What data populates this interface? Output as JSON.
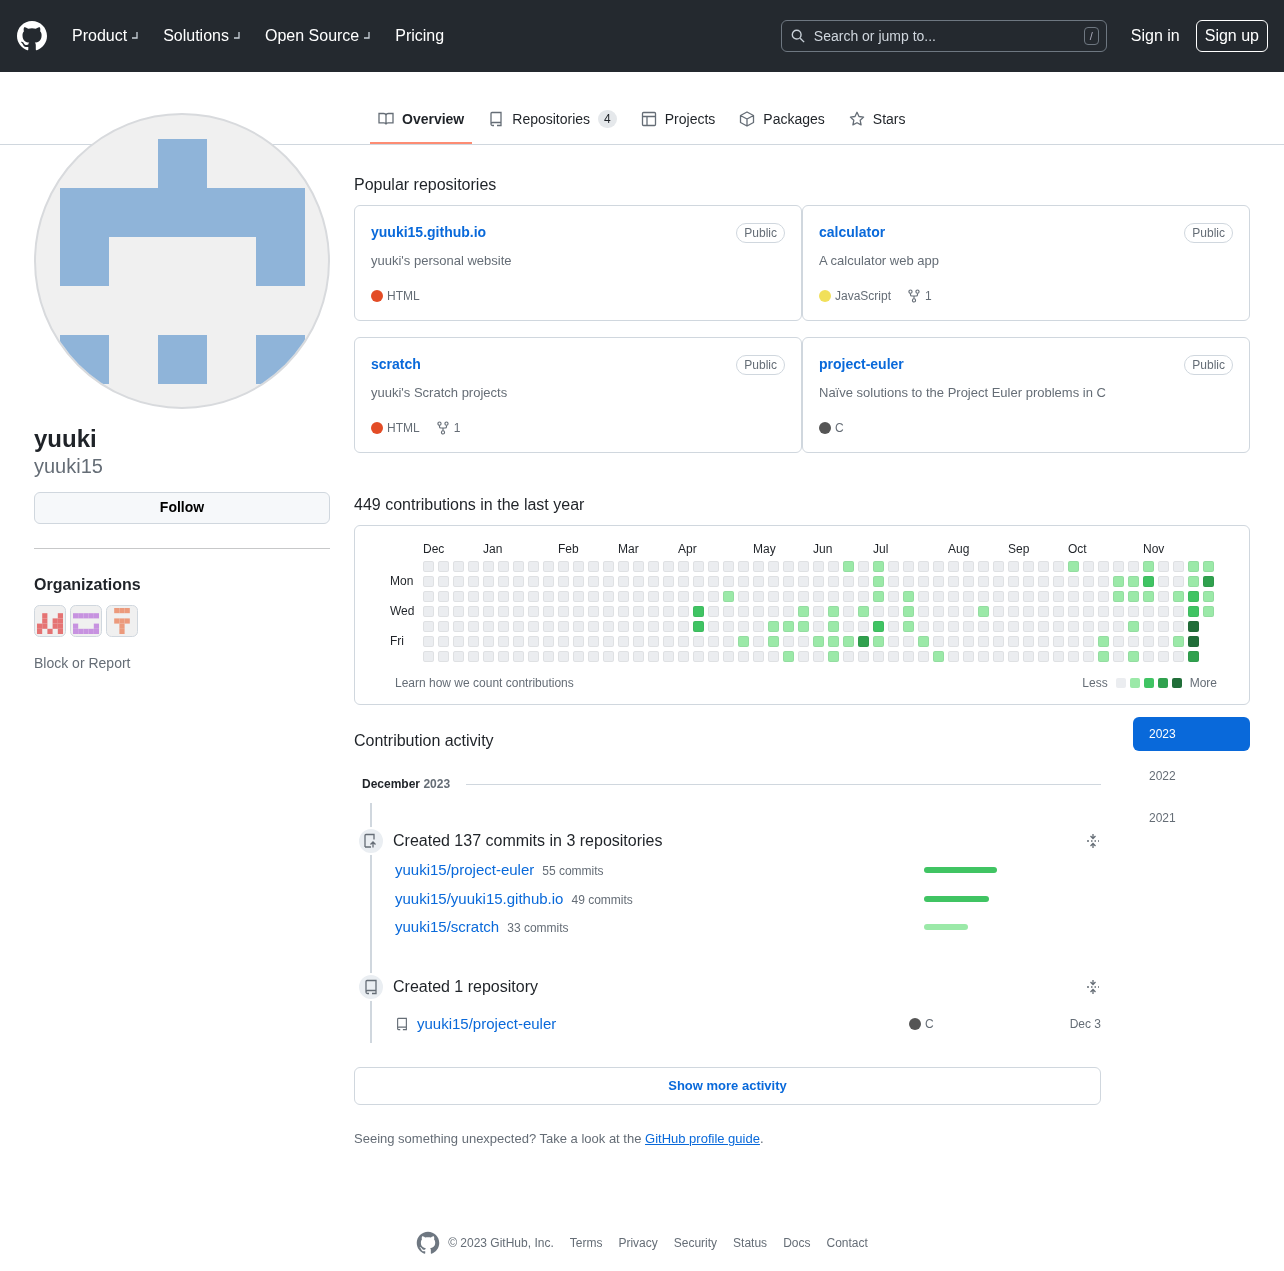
{
  "header": {
    "nav": [
      {
        "label": "Product",
        "dropdown": true
      },
      {
        "label": "Solutions",
        "dropdown": true
      },
      {
        "label": "Open Source",
        "dropdown": true
      },
      {
        "label": "Pricing",
        "dropdown": false
      }
    ],
    "search": {
      "placeholder": "Search or jump to...",
      "shortcut": "/"
    },
    "sign_in": "Sign in",
    "sign_up": "Sign up"
  },
  "tabs": [
    {
      "label": "Overview",
      "selected": true
    },
    {
      "label": "Repositories",
      "count": "4",
      "selected": false
    },
    {
      "label": "Projects",
      "selected": false
    },
    {
      "label": "Packages",
      "selected": false
    },
    {
      "label": "Stars",
      "selected": false
    }
  ],
  "profile": {
    "name": "yuuki",
    "username": "yuuki15",
    "follow": "Follow",
    "organizations_title": "Organizations",
    "organizations": [
      {
        "color": "#e57373"
      },
      {
        "color": "#c792e0"
      },
      {
        "color": "#ec9a7c"
      }
    ],
    "block_report": "Block or Report"
  },
  "popular": {
    "title": "Popular repositories",
    "repos": [
      {
        "name": "yuuki15.github.io",
        "visibility": "Public",
        "description": "yuuki's personal website",
        "language": "HTML",
        "color": "#e34c26"
      },
      {
        "name": "calculator",
        "visibility": "Public",
        "description": "A calculator web app",
        "language": "JavaScript",
        "color": "#f1e05a",
        "forks": "1"
      },
      {
        "name": "scratch",
        "visibility": "Public",
        "description": "yuuki's Scratch projects",
        "language": "HTML",
        "color": "#e34c26",
        "forks": "1"
      },
      {
        "name": "project-euler",
        "visibility": "Public",
        "description": "Naïve solutions to the Project Euler problems in C",
        "language": "C",
        "color": "#555555"
      }
    ]
  },
  "contributions": {
    "title": "449 contributions in the last year",
    "day_labels": [
      "Mon",
      "Wed",
      "Fri"
    ],
    "learn_link": "Learn how we count contributions",
    "legend": {
      "less": "Less",
      "more": "More",
      "swatches": [
        {
          "color": "#ebedf0"
        },
        {
          "color": "#9be9a8"
        },
        {
          "color": "#40c463"
        },
        {
          "color": "#30a14e"
        },
        {
          "color": "#216e39"
        }
      ]
    },
    "weeks": [
      {
        "month": "Dec",
        "days": [
          {
            "color": "#ebedf0"
          },
          {
            "color": "#ebedf0"
          },
          {
            "color": "#ebedf0"
          },
          {
            "color": "#ebedf0"
          },
          {
            "color": "#ebedf0"
          },
          {
            "color": "#ebedf0"
          },
          {
            "color": "#ebedf0"
          }
        ]
      },
      {
        "days": [
          {
            "color": "#ebedf0"
          },
          {
            "color": "#ebedf0"
          },
          {
            "color": "#ebedf0"
          },
          {
            "color": "#ebedf0"
          },
          {
            "color": "#ebedf0"
          },
          {
            "color": "#ebedf0"
          },
          {
            "color": "#ebedf0"
          }
        ]
      },
      {
        "days": [
          {
            "color": "#ebedf0"
          },
          {
            "color": "#ebedf0"
          },
          {
            "color": "#ebedf0"
          },
          {
            "color": "#ebedf0"
          },
          {
            "color": "#ebedf0"
          },
          {
            "color": "#ebedf0"
          },
          {
            "color": "#ebedf0"
          }
        ]
      },
      {
        "days": [
          {
            "color": "#ebedf0"
          },
          {
            "color": "#ebedf0"
          },
          {
            "color": "#ebedf0"
          },
          {
            "color": "#ebedf0"
          },
          {
            "color": "#ebedf0"
          },
          {
            "color": "#ebedf0"
          },
          {
            "color": "#ebedf0"
          }
        ]
      },
      {
        "month": "Jan",
        "days": [
          {
            "color": "#ebedf0"
          },
          {
            "color": "#ebedf0"
          },
          {
            "color": "#ebedf0"
          },
          {
            "color": "#ebedf0"
          },
          {
            "color": "#ebedf0"
          },
          {
            "color": "#ebedf0"
          },
          {
            "color": "#ebedf0"
          }
        ]
      },
      {
        "days": [
          {
            "color": "#ebedf0"
          },
          {
            "color": "#ebedf0"
          },
          {
            "color": "#ebedf0"
          },
          {
            "color": "#ebedf0"
          },
          {
            "color": "#ebedf0"
          },
          {
            "color": "#ebedf0"
          },
          {
            "color": "#ebedf0"
          }
        ]
      },
      {
        "days": [
          {
            "color": "#ebedf0"
          },
          {
            "color": "#ebedf0"
          },
          {
            "color": "#ebedf0"
          },
          {
            "color": "#ebedf0"
          },
          {
            "color": "#ebedf0"
          },
          {
            "color": "#ebedf0"
          },
          {
            "color": "#ebedf0"
          }
        ]
      },
      {
        "days": [
          {
            "color": "#ebedf0"
          },
          {
            "color": "#ebedf0"
          },
          {
            "color": "#ebedf0"
          },
          {
            "color": "#ebedf0"
          },
          {
            "color": "#ebedf0"
          },
          {
            "color": "#ebedf0"
          },
          {
            "color": "#ebedf0"
          }
        ]
      },
      {
        "days": [
          {
            "color": "#ebedf0"
          },
          {
            "color": "#ebedf0"
          },
          {
            "color": "#ebedf0"
          },
          {
            "color": "#ebedf0"
          },
          {
            "color": "#ebedf0"
          },
          {
            "color": "#ebedf0"
          },
          {
            "color": "#ebedf0"
          }
        ]
      },
      {
        "month": "Feb",
        "days": [
          {
            "color": "#ebedf0"
          },
          {
            "color": "#ebedf0"
          },
          {
            "color": "#ebedf0"
          },
          {
            "color": "#ebedf0"
          },
          {
            "color": "#ebedf0"
          },
          {
            "color": "#ebedf0"
          },
          {
            "color": "#ebedf0"
          }
        ]
      },
      {
        "days": [
          {
            "color": "#ebedf0"
          },
          {
            "color": "#ebedf0"
          },
          {
            "color": "#ebedf0"
          },
          {
            "color": "#ebedf0"
          },
          {
            "color": "#ebedf0"
          },
          {
            "color": "#ebedf0"
          },
          {
            "color": "#ebedf0"
          }
        ]
      },
      {
        "days": [
          {
            "color": "#ebedf0"
          },
          {
            "color": "#ebedf0"
          },
          {
            "color": "#ebedf0"
          },
          {
            "color": "#ebedf0"
          },
          {
            "color": "#ebedf0"
          },
          {
            "color": "#ebedf0"
          },
          {
            "color": "#ebedf0"
          }
        ]
      },
      {
        "days": [
          {
            "color": "#ebedf0"
          },
          {
            "color": "#ebedf0"
          },
          {
            "color": "#ebedf0"
          },
          {
            "color": "#ebedf0"
          },
          {
            "color": "#ebedf0"
          },
          {
            "color": "#ebedf0"
          },
          {
            "color": "#ebedf0"
          }
        ]
      },
      {
        "month": "Mar",
        "days": [
          {
            "color": "#ebedf0"
          },
          {
            "color": "#ebedf0"
          },
          {
            "color": "#ebedf0"
          },
          {
            "color": "#ebedf0"
          },
          {
            "color": "#ebedf0"
          },
          {
            "color": "#ebedf0"
          },
          {
            "color": "#ebedf0"
          }
        ]
      },
      {
        "days": [
          {
            "color": "#ebedf0"
          },
          {
            "color": "#ebedf0"
          },
          {
            "color": "#ebedf0"
          },
          {
            "color": "#ebedf0"
          },
          {
            "color": "#ebedf0"
          },
          {
            "color": "#ebedf0"
          },
          {
            "color": "#ebedf0"
          }
        ]
      },
      {
        "days": [
          {
            "color": "#ebedf0"
          },
          {
            "color": "#ebedf0"
          },
          {
            "color": "#ebedf0"
          },
          {
            "color": "#ebedf0"
          },
          {
            "color": "#ebedf0"
          },
          {
            "color": "#ebedf0"
          },
          {
            "color": "#ebedf0"
          }
        ]
      },
      {
        "days": [
          {
            "color": "#ebedf0"
          },
          {
            "color": "#ebedf0"
          },
          {
            "color": "#ebedf0"
          },
          {
            "color": "#ebedf0"
          },
          {
            "color": "#ebedf0"
          },
          {
            "color": "#ebedf0"
          },
          {
            "color": "#ebedf0"
          }
        ]
      },
      {
        "month": "Apr",
        "days": [
          {
            "color": "#ebedf0"
          },
          {
            "color": "#ebedf0"
          },
          {
            "color": "#ebedf0"
          },
          {
            "color": "#ebedf0"
          },
          {
            "color": "#ebedf0"
          },
          {
            "color": "#ebedf0"
          },
          {
            "color": "#ebedf0"
          }
        ]
      },
      {
        "days": [
          {
            "color": "#ebedf0"
          },
          {
            "color": "#ebedf0"
          },
          {
            "color": "#ebedf0"
          },
          {
            "color": "#40c463"
          },
          {
            "color": "#40c463"
          },
          {
            "color": "#ebedf0"
          },
          {
            "color": "#ebedf0"
          }
        ]
      },
      {
        "days": [
          {
            "color": "#ebedf0"
          },
          {
            "color": "#ebedf0"
          },
          {
            "color": "#ebedf0"
          },
          {
            "color": "#ebedf0"
          },
          {
            "color": "#ebedf0"
          },
          {
            "color": "#ebedf0"
          },
          {
            "color": "#ebedf0"
          }
        ]
      },
      {
        "days": [
          {
            "color": "#ebedf0"
          },
          {
            "color": "#ebedf0"
          },
          {
            "color": "#9be9a8"
          },
          {
            "color": "#ebedf0"
          },
          {
            "color": "#ebedf0"
          },
          {
            "color": "#ebedf0"
          },
          {
            "color": "#ebedf0"
          }
        ]
      },
      {
        "days": [
          {
            "color": "#ebedf0"
          },
          {
            "color": "#ebedf0"
          },
          {
            "color": "#ebedf0"
          },
          {
            "color": "#ebedf0"
          },
          {
            "color": "#ebedf0"
          },
          {
            "color": "#9be9a8"
          },
          {
            "color": "#ebedf0"
          }
        ]
      },
      {
        "month": "May",
        "days": [
          {
            "color": "#ebedf0"
          },
          {
            "color": "#ebedf0"
          },
          {
            "color": "#ebedf0"
          },
          {
            "color": "#ebedf0"
          },
          {
            "color": "#ebedf0"
          },
          {
            "color": "#ebedf0"
          },
          {
            "color": "#ebedf0"
          }
        ]
      },
      {
        "days": [
          {
            "color": "#ebedf0"
          },
          {
            "color": "#ebedf0"
          },
          {
            "color": "#ebedf0"
          },
          {
            "color": "#ebedf0"
          },
          {
            "color": "#9be9a8"
          },
          {
            "color": "#9be9a8"
          },
          {
            "color": "#ebedf0"
          }
        ]
      },
      {
        "days": [
          {
            "color": "#ebedf0"
          },
          {
            "color": "#ebedf0"
          },
          {
            "color": "#ebedf0"
          },
          {
            "color": "#ebedf0"
          },
          {
            "color": "#9be9a8"
          },
          {
            "color": "#ebedf0"
          },
          {
            "color": "#9be9a8"
          }
        ]
      },
      {
        "days": [
          {
            "color": "#ebedf0"
          },
          {
            "color": "#ebedf0"
          },
          {
            "color": "#ebedf0"
          },
          {
            "color": "#9be9a8"
          },
          {
            "color": "#9be9a8"
          },
          {
            "color": "#ebedf0"
          },
          {
            "color": "#ebedf0"
          }
        ]
      },
      {
        "month": "Jun",
        "days": [
          {
            "color": "#ebedf0"
          },
          {
            "color": "#ebedf0"
          },
          {
            "color": "#ebedf0"
          },
          {
            "color": "#ebedf0"
          },
          {
            "color": "#ebedf0"
          },
          {
            "color": "#9be9a8"
          },
          {
            "color": "#ebedf0"
          }
        ]
      },
      {
        "days": [
          {
            "color": "#ebedf0"
          },
          {
            "color": "#ebedf0"
          },
          {
            "color": "#ebedf0"
          },
          {
            "color": "#9be9a8"
          },
          {
            "color": "#9be9a8"
          },
          {
            "color": "#9be9a8"
          },
          {
            "color": "#9be9a8"
          }
        ]
      },
      {
        "days": [
          {
            "color": "#9be9a8"
          },
          {
            "color": "#ebedf0"
          },
          {
            "color": "#ebedf0"
          },
          {
            "color": "#ebedf0"
          },
          {
            "color": "#ebedf0"
          },
          {
            "color": "#9be9a8"
          },
          {
            "color": "#ebedf0"
          }
        ]
      },
      {
        "days": [
          {
            "color": "#ebedf0"
          },
          {
            "color": "#ebedf0"
          },
          {
            "color": "#ebedf0"
          },
          {
            "color": "#9be9a8"
          },
          {
            "color": "#ebedf0"
          },
          {
            "color": "#30a14e"
          },
          {
            "color": "#ebedf0"
          }
        ]
      },
      {
        "month": "Jul",
        "days": [
          {
            "color": "#9be9a8"
          },
          {
            "color": "#9be9a8"
          },
          {
            "color": "#9be9a8"
          },
          {
            "color": "#ebedf0"
          },
          {
            "color": "#40c463"
          },
          {
            "color": "#9be9a8"
          },
          {
            "color": "#ebedf0"
          }
        ]
      },
      {
        "days": [
          {
            "color": "#ebedf0"
          },
          {
            "color": "#ebedf0"
          },
          {
            "color": "#ebedf0"
          },
          {
            "color": "#ebedf0"
          },
          {
            "color": "#ebedf0"
          },
          {
            "color": "#ebedf0"
          },
          {
            "color": "#ebedf0"
          }
        ]
      },
      {
        "days": [
          {
            "color": "#ebedf0"
          },
          {
            "color": "#ebedf0"
          },
          {
            "color": "#9be9a8"
          },
          {
            "color": "#9be9a8"
          },
          {
            "color": "#9be9a8"
          },
          {
            "color": "#ebedf0"
          },
          {
            "color": "#ebedf0"
          }
        ]
      },
      {
        "days": [
          {
            "color": "#ebedf0"
          },
          {
            "color": "#ebedf0"
          },
          {
            "color": "#ebedf0"
          },
          {
            "color": "#ebedf0"
          },
          {
            "color": "#ebedf0"
          },
          {
            "color": "#9be9a8"
          },
          {
            "color": "#ebedf0"
          }
        ]
      },
      {
        "days": [
          {
            "color": "#ebedf0"
          },
          {
            "color": "#ebedf0"
          },
          {
            "color": "#ebedf0"
          },
          {
            "color": "#ebedf0"
          },
          {
            "color": "#ebedf0"
          },
          {
            "color": "#ebedf0"
          },
          {
            "color": "#9be9a8"
          }
        ]
      },
      {
        "month": "Aug",
        "days": [
          {
            "color": "#ebedf0"
          },
          {
            "color": "#ebedf0"
          },
          {
            "color": "#ebedf0"
          },
          {
            "color": "#ebedf0"
          },
          {
            "color": "#ebedf0"
          },
          {
            "color": "#ebedf0"
          },
          {
            "color": "#ebedf0"
          }
        ]
      },
      {
        "days": [
          {
            "color": "#ebedf0"
          },
          {
            "color": "#ebedf0"
          },
          {
            "color": "#ebedf0"
          },
          {
            "color": "#ebedf0"
          },
          {
            "color": "#ebedf0"
          },
          {
            "color": "#ebedf0"
          },
          {
            "color": "#ebedf0"
          }
        ]
      },
      {
        "days": [
          {
            "color": "#ebedf0"
          },
          {
            "color": "#ebedf0"
          },
          {
            "color": "#ebedf0"
          },
          {
            "color": "#9be9a8"
          },
          {
            "color": "#ebedf0"
          },
          {
            "color": "#ebedf0"
          },
          {
            "color": "#ebedf0"
          }
        ]
      },
      {
        "days": [
          {
            "color": "#ebedf0"
          },
          {
            "color": "#ebedf0"
          },
          {
            "color": "#ebedf0"
          },
          {
            "color": "#ebedf0"
          },
          {
            "color": "#ebedf0"
          },
          {
            "color": "#ebedf0"
          },
          {
            "color": "#ebedf0"
          }
        ]
      },
      {
        "month": "Sep",
        "days": [
          {
            "color": "#ebedf0"
          },
          {
            "color": "#ebedf0"
          },
          {
            "color": "#ebedf0"
          },
          {
            "color": "#ebedf0"
          },
          {
            "color": "#ebedf0"
          },
          {
            "color": "#ebedf0"
          },
          {
            "color": "#ebedf0"
          }
        ]
      },
      {
        "days": [
          {
            "color": "#ebedf0"
          },
          {
            "color": "#ebedf0"
          },
          {
            "color": "#ebedf0"
          },
          {
            "color": "#ebedf0"
          },
          {
            "color": "#ebedf0"
          },
          {
            "color": "#ebedf0"
          },
          {
            "color": "#ebedf0"
          }
        ]
      },
      {
        "days": [
          {
            "color": "#ebedf0"
          },
          {
            "color": "#ebedf0"
          },
          {
            "color": "#ebedf0"
          },
          {
            "color": "#ebedf0"
          },
          {
            "color": "#ebedf0"
          },
          {
            "color": "#ebedf0"
          },
          {
            "color": "#ebedf0"
          }
        ]
      },
      {
        "days": [
          {
            "color": "#ebedf0"
          },
          {
            "color": "#ebedf0"
          },
          {
            "color": "#ebedf0"
          },
          {
            "color": "#ebedf0"
          },
          {
            "color": "#ebedf0"
          },
          {
            "color": "#ebedf0"
          },
          {
            "color": "#ebedf0"
          }
        ]
      },
      {
        "month": "Oct",
        "days": [
          {
            "color": "#9be9a8"
          },
          {
            "color": "#ebedf0"
          },
          {
            "color": "#ebedf0"
          },
          {
            "color": "#ebedf0"
          },
          {
            "color": "#ebedf0"
          },
          {
            "color": "#ebedf0"
          },
          {
            "color": "#ebedf0"
          }
        ]
      },
      {
        "days": [
          {
            "color": "#ebedf0"
          },
          {
            "color": "#ebedf0"
          },
          {
            "color": "#ebedf0"
          },
          {
            "color": "#ebedf0"
          },
          {
            "color": "#ebedf0"
          },
          {
            "color": "#ebedf0"
          },
          {
            "color": "#ebedf0"
          }
        ]
      },
      {
        "days": [
          {
            "color": "#ebedf0"
          },
          {
            "color": "#ebedf0"
          },
          {
            "color": "#ebedf0"
          },
          {
            "color": "#ebedf0"
          },
          {
            "color": "#ebedf0"
          },
          {
            "color": "#9be9a8"
          },
          {
            "color": "#9be9a8"
          }
        ]
      },
      {
        "days": [
          {
            "color": "#ebedf0"
          },
          {
            "color": "#9be9a8"
          },
          {
            "color": "#9be9a8"
          },
          {
            "color": "#ebedf0"
          },
          {
            "color": "#ebedf0"
          },
          {
            "color": "#ebedf0"
          },
          {
            "color": "#ebedf0"
          }
        ]
      },
      {
        "days": [
          {
            "color": "#ebedf0"
          },
          {
            "color": "#9be9a8"
          },
          {
            "color": "#9be9a8"
          },
          {
            "color": "#ebedf0"
          },
          {
            "color": "#9be9a8"
          },
          {
            "color": "#ebedf0"
          },
          {
            "color": "#9be9a8"
          }
        ]
      },
      {
        "month": "Nov",
        "days": [
          {
            "color": "#9be9a8"
          },
          {
            "color": "#40c463"
          },
          {
            "color": "#9be9a8"
          },
          {
            "color": "#ebedf0"
          },
          {
            "color": "#ebedf0"
          },
          {
            "color": "#ebedf0"
          },
          {
            "color": "#ebedf0"
          }
        ]
      },
      {
        "days": [
          {
            "color": "#ebedf0"
          },
          {
            "color": "#ebedf0"
          },
          {
            "color": "#ebedf0"
          },
          {
            "color": "#ebedf0"
          },
          {
            "color": "#ebedf0"
          },
          {
            "color": "#ebedf0"
          },
          {
            "color": "#ebedf0"
          }
        ]
      },
      {
        "days": [
          {
            "color": "#ebedf0"
          },
          {
            "color": "#ebedf0"
          },
          {
            "color": "#9be9a8"
          },
          {
            "color": "#ebedf0"
          },
          {
            "color": "#ebedf0"
          },
          {
            "color": "#9be9a8"
          },
          {
            "color": "#ebedf0"
          }
        ]
      },
      {
        "days": [
          {
            "color": "#9be9a8"
          },
          {
            "color": "#9be9a8"
          },
          {
            "color": "#40c463"
          },
          {
            "color": "#40c463"
          },
          {
            "color": "#216e39"
          },
          {
            "color": "#216e39"
          },
          {
            "color": "#30a14e"
          }
        ]
      },
      {
        "days": [
          {
            "color": "#9be9a8"
          },
          {
            "color": "#30a14e"
          },
          {
            "color": "#9be9a8"
          },
          {
            "color": "#9be9a8"
          }
        ]
      }
    ]
  },
  "activity": {
    "title": "Contribution activity",
    "month": "December",
    "year": "2023",
    "events": [
      {
        "kind": "commits",
        "title": "Created 137 commits in 3 repositories",
        "repos": [
          {
            "name": "yuuki15/project-euler",
            "commits": "55 commits",
            "color": "#40c463"
          },
          {
            "name": "yuuki15/yuuki15.github.io",
            "commits": "49 commits",
            "color": "#40c463"
          },
          {
            "name": "yuuki15/scratch",
            "commits": "33 commits",
            "color": "#9be9a8"
          }
        ]
      },
      {
        "kind": "repository",
        "title": "Created 1 repository",
        "repos": [
          {
            "name": "yuuki15/project-euler",
            "language": "C",
            "color": "#555555",
            "date": "Dec 3"
          }
        ]
      }
    ],
    "show_more": "Show more activity",
    "years": [
      {
        "label": "2023",
        "selected": true
      },
      {
        "label": "2022",
        "selected": false
      },
      {
        "label": "2021",
        "selected": false
      }
    ]
  },
  "note": {
    "text": "Seeing something unexpected? Take a look at the",
    "link": "GitHub profile guide",
    "end": "."
  },
  "footer": {
    "copyright": "© 2023 GitHub, Inc.",
    "links": [
      "Terms",
      "Privacy",
      "Security",
      "Status",
      "Docs",
      "Contact"
    ]
  }
}
